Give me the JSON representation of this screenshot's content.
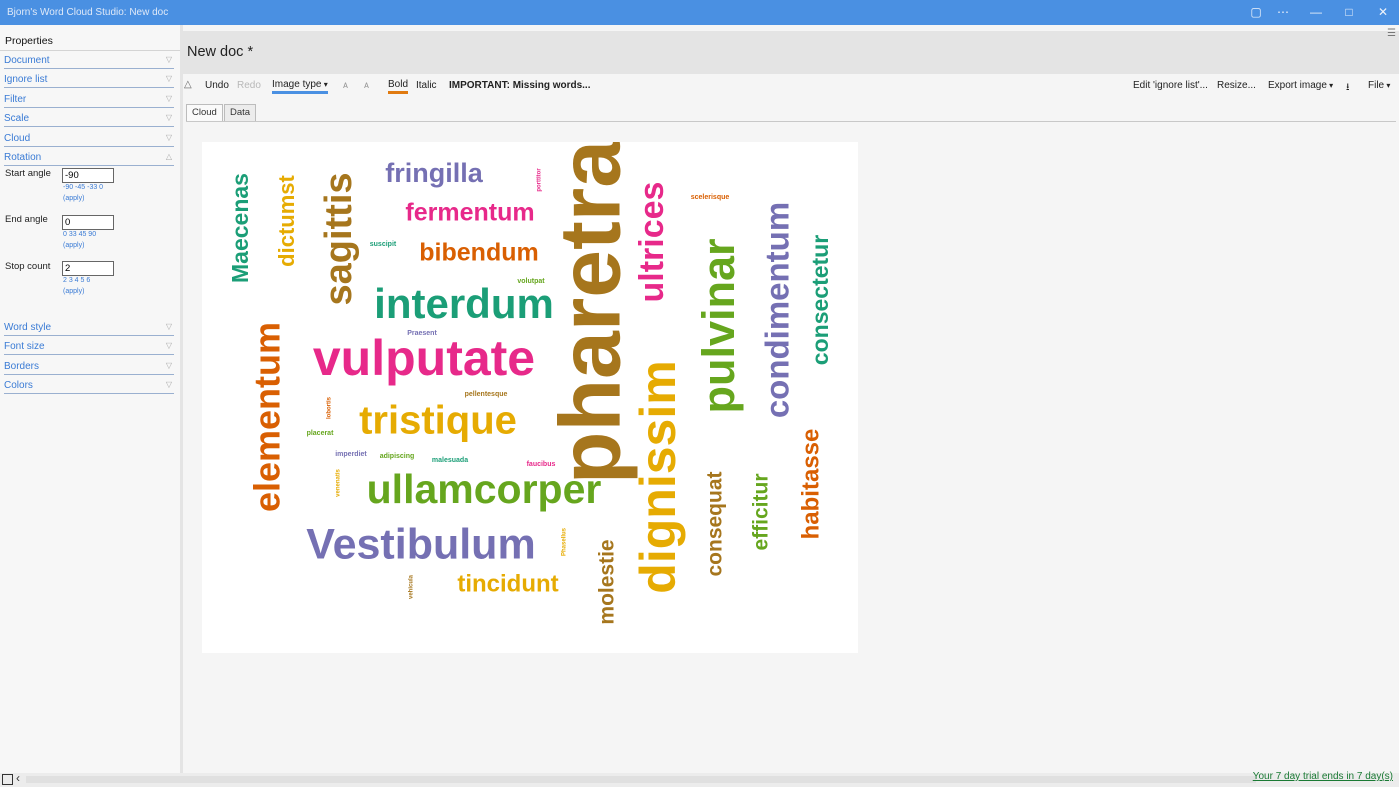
{
  "window": {
    "title": "Bjorn's Word Cloud Studio: New doc",
    "controls": [
      "doc-icon",
      "more-icon",
      "minimize-icon",
      "maximize-icon",
      "close-icon"
    ]
  },
  "sidebar": {
    "header": "Properties",
    "sections": [
      "Document",
      "Ignore list",
      "Filter",
      "Scale",
      "Cloud",
      "Rotation",
      "Word style",
      "Font size",
      "Borders",
      "Colors"
    ],
    "rotation": {
      "start_label": "Start angle",
      "start_value": "-90",
      "start_hint": "-90 -45 -33 0",
      "end_label": "End angle",
      "end_value": "0",
      "end_hint": "0 33 45 90",
      "stop_label": "Stop count",
      "stop_value": "2",
      "stop_hint": "2 3 4 5 6",
      "apply": "(apply)"
    }
  },
  "doc": {
    "title": "New doc *"
  },
  "toolbar": {
    "undo": "Undo",
    "redo": "Redo",
    "image_type": "Image type",
    "bold": "Bold",
    "italic": "Italic",
    "missing": "IMPORTANT: Missing words...",
    "edit_ignore": "Edit 'ignore list'...",
    "resize": "Resize...",
    "export": "Export image",
    "file": "File"
  },
  "tabs": [
    "Cloud",
    "Data"
  ],
  "status": {
    "trial": "Your 7 day trial ends in 7 day(s)"
  },
  "colors": {
    "teal": "#1b9e77",
    "orange": "#d95f02",
    "purple": "#7570b3",
    "magenta": "#e7298a",
    "green": "#66a61e",
    "gold": "#e6ab02",
    "brown": "#a6761d",
    "accent": "#4a90e2"
  },
  "words": [
    {
      "text": "pharetra",
      "color": "brown"
    },
    {
      "text": "vulputate",
      "color": "magenta"
    },
    {
      "text": "dignissim",
      "color": "gold"
    },
    {
      "text": "interdum",
      "color": "teal"
    },
    {
      "text": "ullamcorper",
      "color": "green"
    },
    {
      "text": "Vestibulum",
      "color": "purple"
    },
    {
      "text": "tristique",
      "color": "gold"
    },
    {
      "text": "pulvinar",
      "color": "green"
    },
    {
      "text": "condimentum",
      "color": "purple"
    },
    {
      "text": "elementum",
      "color": "orange"
    },
    {
      "text": "sagittis",
      "color": "brown"
    },
    {
      "text": "ultrices",
      "color": "magenta"
    },
    {
      "text": "consectetur",
      "color": "teal"
    },
    {
      "text": "fringilla",
      "color": "purple"
    },
    {
      "text": "fermentum",
      "color": "magenta"
    },
    {
      "text": "bibendum",
      "color": "orange"
    },
    {
      "text": "tincidunt",
      "color": "gold"
    },
    {
      "text": "Maecenas",
      "color": "teal"
    },
    {
      "text": "dictumst",
      "color": "gold"
    },
    {
      "text": "habitasse",
      "color": "orange"
    },
    {
      "text": "consequat",
      "color": "brown"
    },
    {
      "text": "efficitur",
      "color": "green"
    },
    {
      "text": "molestie",
      "color": "brown"
    },
    {
      "text": "scelerisque",
      "color": "orange"
    },
    {
      "text": "porttitor",
      "color": "magenta"
    },
    {
      "text": "suscipit",
      "color": "teal"
    },
    {
      "text": "volutpat",
      "color": "green"
    },
    {
      "text": "Praesent",
      "color": "purple"
    },
    {
      "text": "pellentesque",
      "color": "brown"
    },
    {
      "text": "lobortis",
      "color": "orange"
    },
    {
      "text": "placerat",
      "color": "green"
    },
    {
      "text": "imperdiet",
      "color": "purple"
    },
    {
      "text": "adipiscing",
      "color": "green"
    },
    {
      "text": "malesuada",
      "color": "teal"
    },
    {
      "text": "faucibus",
      "color": "magenta"
    },
    {
      "text": "venenatis",
      "color": "gold"
    },
    {
      "text": "Phasellus",
      "color": "gold"
    },
    {
      "text": "vehicula",
      "color": "brown"
    }
  ]
}
